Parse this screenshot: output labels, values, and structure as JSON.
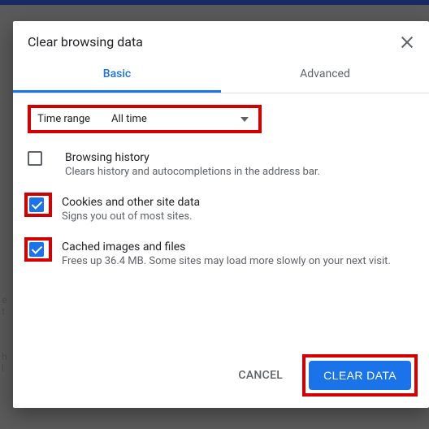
{
  "dialog": {
    "title": "Clear browsing data",
    "tabs": {
      "basic": "Basic",
      "advanced": "Advanced"
    },
    "time_range": {
      "label": "Time range",
      "value": "All time"
    },
    "options": [
      {
        "title": "Browsing history",
        "subtitle": "Clears history and autocompletions in the address bar.",
        "checked": false,
        "highlight": false
      },
      {
        "title": "Cookies and other site data",
        "subtitle": "Signs you out of most sites.",
        "checked": true,
        "highlight": true
      },
      {
        "title": "Cached images and files",
        "subtitle": "Frees up 36.4 MB. Some sites may load more slowly on your next visit.",
        "checked": true,
        "highlight": true
      }
    ],
    "buttons": {
      "cancel": "CANCEL",
      "clear": "CLEAR DATA"
    }
  },
  "bg": {
    "a": "e",
    "b": "t",
    "c": "h",
    "d": "l"
  }
}
